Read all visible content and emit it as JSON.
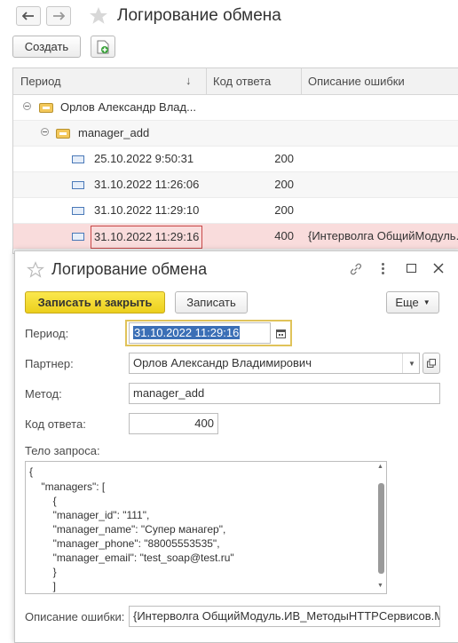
{
  "window": {
    "title": "Логирование обмена"
  },
  "toolbar": {
    "create_label": "Создать"
  },
  "list": {
    "columns": [
      "Период",
      "Код ответа",
      "Описание ошибки"
    ],
    "sort_indicator": "↓",
    "group1": "Орлов Александр Влад...",
    "group2": "manager_add",
    "rows": [
      {
        "period": "25.10.2022 9:50:31",
        "code": "200",
        "error": ""
      },
      {
        "period": "31.10.2022 11:26:06",
        "code": "200",
        "error": ""
      },
      {
        "period": "31.10.2022 11:29:10",
        "code": "200",
        "error": ""
      },
      {
        "period": "31.10.2022 11:29:16",
        "code": "400",
        "error": "{Интерволга ОбщийМодуль."
      }
    ]
  },
  "dialog": {
    "title": "Логирование обмена",
    "save_close_label": "Записать и закрыть",
    "save_label": "Записать",
    "more_label": "Еще",
    "period_label": "Период:",
    "period_value": "31.10.2022 11:29:16",
    "partner_label": "Партнер:",
    "partner_value": "Орлов Александр Владимирович",
    "method_label": "Метод:",
    "method_value": "manager_add",
    "code_label": "Код ответа:",
    "code_value": "400",
    "body_label": "Тело запроса:",
    "body_lines": [
      "{",
      "    \"managers\": [",
      "        {",
      "        \"manager_id\": \"111\",",
      "        \"manager_name\": \"Супер манагер\",",
      "        \"manager_phone\": \"88005553535\",",
      "        \"manager_email\": \"test_soap@test.ru\"",
      "        }",
      "        ]"
    ],
    "error_label": "Описание ошибки:",
    "error_value": "{Интерволга ОбщийМодуль.ИВ_МетодыHTTPСервисов.М"
  },
  "colors": {
    "accent_yellow": "#f5dc2a",
    "selected_row": "#f9dcdc",
    "selected_text_bg": "#3b6fb6",
    "focus_border": "#e0c35a"
  }
}
